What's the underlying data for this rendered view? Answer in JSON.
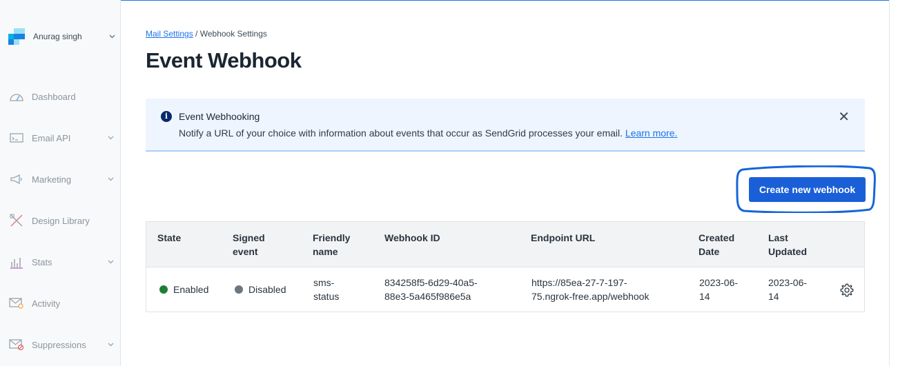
{
  "account": {
    "name": "Anurag singh",
    "logo_colors": [
      "#1a82e2",
      "#99e1f4",
      "#00b3e3",
      "#294661"
    ]
  },
  "sidebar": {
    "items": [
      {
        "label": "Dashboard",
        "icon": "gauge-icon",
        "has_chevron": false
      },
      {
        "label": "Email API",
        "icon": "code-window-icon",
        "has_chevron": true
      },
      {
        "label": "Marketing",
        "icon": "megaphone-icon",
        "has_chevron": true
      },
      {
        "label": "Design Library",
        "icon": "pencil-ruler-icon",
        "has_chevron": false
      },
      {
        "label": "Stats",
        "icon": "bar-chart-icon",
        "has_chevron": true
      },
      {
        "label": "Activity",
        "icon": "mail-search-icon",
        "has_chevron": false
      },
      {
        "label": "Suppressions",
        "icon": "mail-blocked-icon",
        "has_chevron": true
      }
    ]
  },
  "breadcrumb": {
    "parent": "Mail Settings",
    "separator": "/",
    "current": "Webhook Settings"
  },
  "page": {
    "title": "Event Webhook"
  },
  "alert": {
    "title": "Event Webhooking",
    "body": "Notify a URL of your choice with information about events that occur as SendGrid processes your email.",
    "link": "Learn more.",
    "close": "✕"
  },
  "actions": {
    "create_label": "Create new webhook"
  },
  "table": {
    "headers": {
      "state": "State",
      "signed_1": "Signed",
      "signed_2": "event",
      "friendly_1": "Friendly",
      "friendly_2": "name",
      "webhook_id": "Webhook ID",
      "endpoint": "Endpoint URL",
      "created_1": "Created",
      "created_2": "Date",
      "updated_1": "Last",
      "updated_2": "Updated"
    },
    "rows": [
      {
        "state": "Enabled",
        "signed": "Disabled",
        "friendly_1": "sms-",
        "friendly_2": "status",
        "id_1": "834258f5-6d29-40a5-",
        "id_2": "88e3-5a465f986e5a",
        "url_1": "https://85ea-27-7-197-",
        "url_2": "75.ngrok-free.app/webhook",
        "created_1": "2023-06-",
        "created_2": "14",
        "updated_1": "2023-06-",
        "updated_2": "14"
      }
    ]
  },
  "colors": {
    "accent": "#1a5fd8",
    "enabled": "#1e7e34",
    "disabled": "#6b7680",
    "annotation": "#1565d8"
  }
}
